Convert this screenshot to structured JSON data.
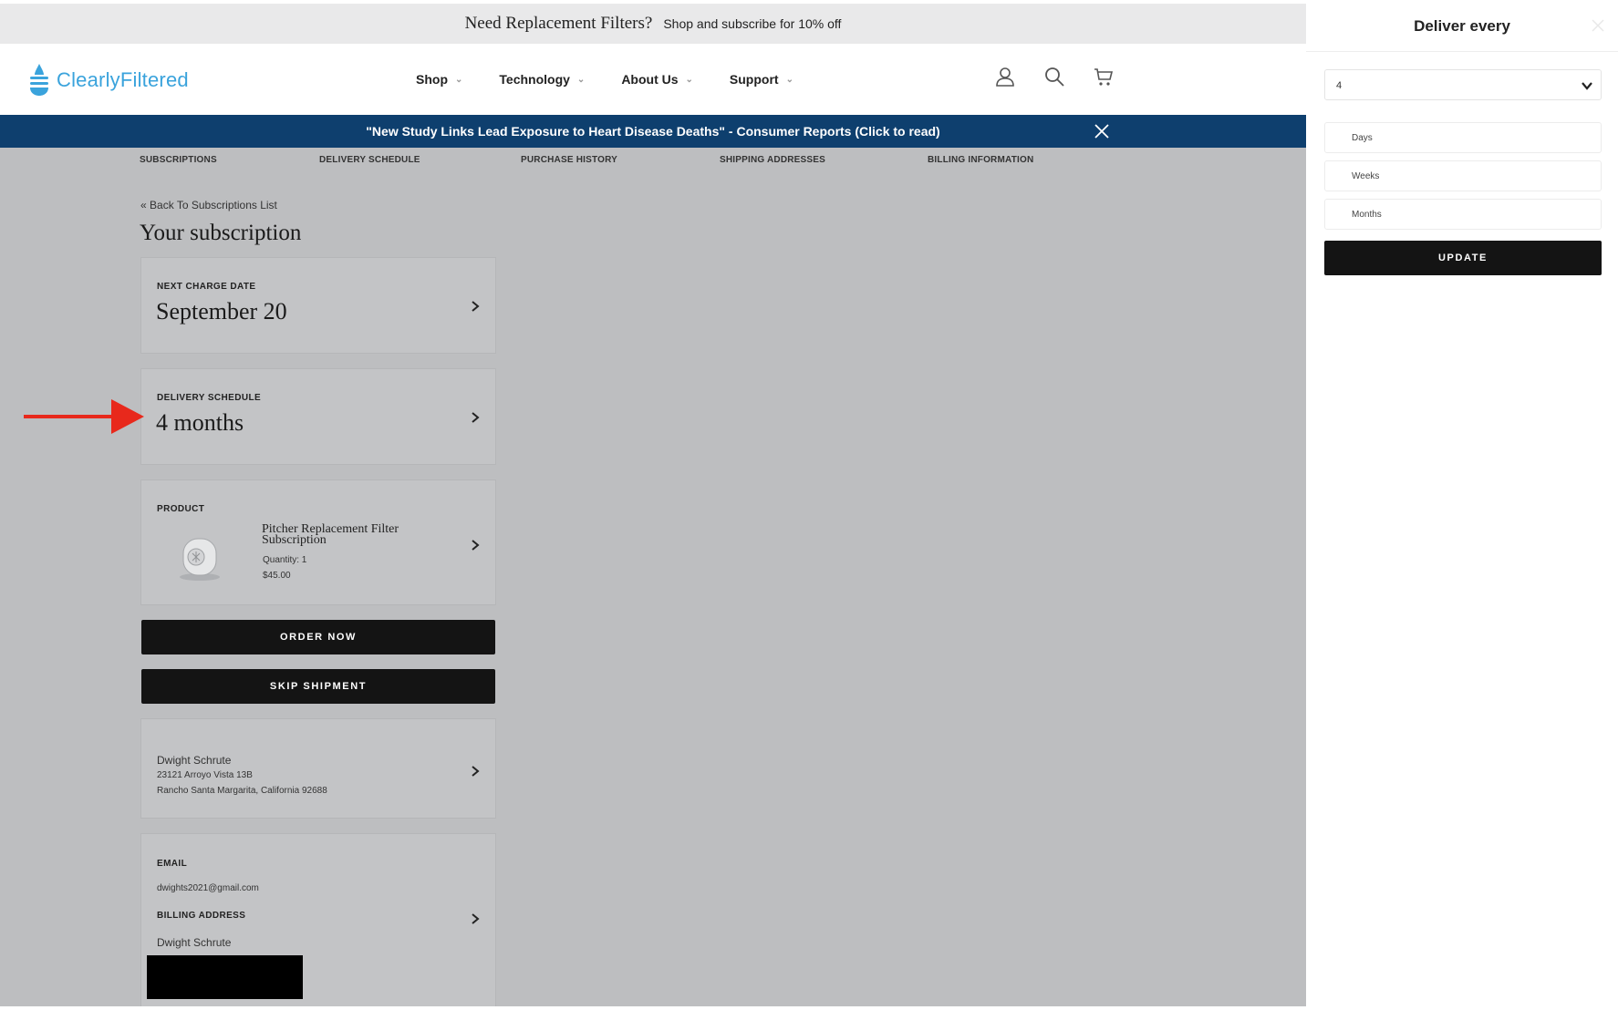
{
  "promo": {
    "headline": "Need Replacement Filters?",
    "subtext": "Shop and subscribe for 10% off"
  },
  "header": {
    "brand": "ClearlyFiltered",
    "nav": [
      {
        "label": "Shop"
      },
      {
        "label": "Technology"
      },
      {
        "label": "About Us"
      },
      {
        "label": "Support"
      }
    ],
    "icons": [
      "account-icon",
      "search-icon",
      "cart-icon"
    ]
  },
  "alert": {
    "text": "\"New Study Links Lead Exposure to Heart Disease Deaths\" - Consumer Reports (Click to read)"
  },
  "tabs": [
    "SUBSCRIPTIONS",
    "DELIVERY SCHEDULE",
    "PURCHASE HISTORY",
    "SHIPPING ADDRESSES",
    "BILLING INFORMATION"
  ],
  "subscription": {
    "back_label": "Back To Subscriptions List",
    "title": "Your subscription",
    "next_charge": {
      "label": "NEXT CHARGE DATE",
      "value": "September 20"
    },
    "delivery": {
      "label": "DELIVERY SCHEDULE",
      "value": "4 months"
    },
    "product": {
      "label": "PRODUCT",
      "name": "Pitcher Replacement Filter Subscription",
      "quantity": "Quantity: 1",
      "price": "$45.00"
    },
    "order_now": "ORDER NOW",
    "skip_shipment": "SKIP SHIPMENT",
    "shipping": {
      "name": "Dwight Schrute",
      "line1": "23121 Arroyo Vista 13B",
      "line2": "Rancho Santa Margarita, California 92688"
    },
    "billing": {
      "email_label": "EMAIL",
      "email": "dwights2021@gmail.com",
      "address_label": "BILLING ADDRESS",
      "name": "Dwight Schrute"
    }
  },
  "panel": {
    "title": "Deliver every",
    "select_value": "4",
    "options": [
      "Days",
      "Weeks",
      "Months"
    ],
    "update_label": "UPDATE"
  },
  "colors": {
    "alert_bg": "#0e3f6e",
    "brand": "#3aa3dc",
    "button": "#141414",
    "pointer": "#e8291c"
  }
}
